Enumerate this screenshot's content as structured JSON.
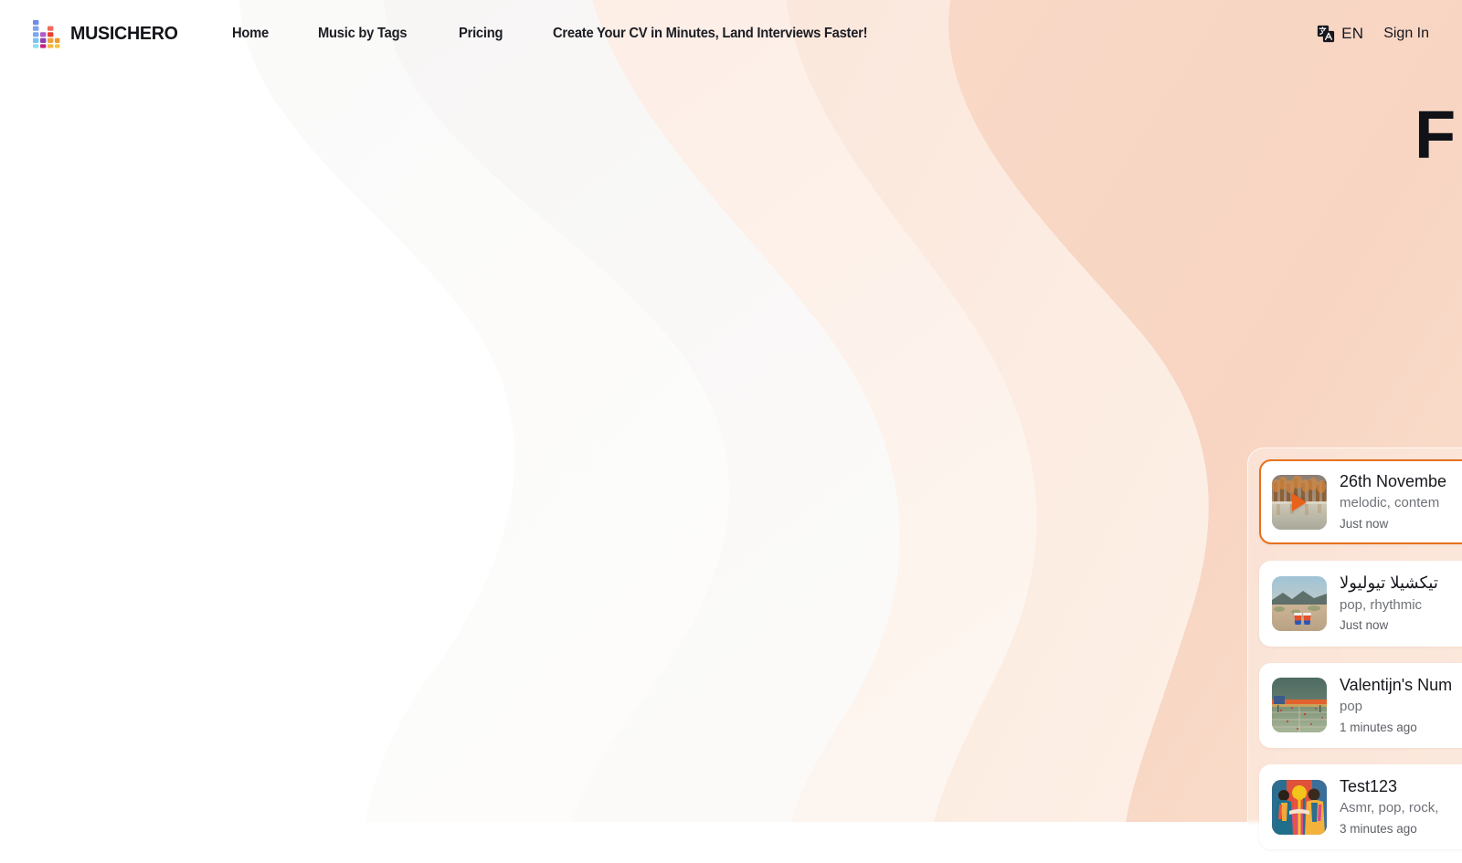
{
  "colors": {
    "accent_orange": "#e8701e",
    "peach_bg": "#f8d7c6",
    "text_dark": "#17181e",
    "text_muted": "#6f7278"
  },
  "header": {
    "brand_name": "MUSICHERO",
    "logo_icon": "equalizer-bars-logo",
    "nav": [
      {
        "label": "Home",
        "name": "home"
      },
      {
        "label": "Music by Tags",
        "name": "music-by-tags"
      },
      {
        "label": "Pricing",
        "name": "pricing"
      },
      {
        "label": "Create Your CV in Minutes, Land Interviews Faster!",
        "name": "cv-promo"
      }
    ],
    "language": {
      "icon": "translate-icon",
      "code": "EN"
    },
    "sign_in_label": "Sign In"
  },
  "hero": {
    "heading_visible_fragment": "F"
  },
  "tracks": [
    {
      "title": "26th Novembe",
      "tags": "melodic, contem",
      "time": "Just now",
      "active": true,
      "playing": true,
      "art": "autumn-lake-reflection"
    },
    {
      "title": "تيكشيلا تيوليولا",
      "tags": "pop, rhythmic",
      "time": "Just now",
      "active": false,
      "playing": false,
      "art": "desert-cocktails"
    },
    {
      "title": "Valentijn's Num",
      "tags": "pop",
      "time": "1 minutes ago",
      "active": false,
      "playing": false,
      "art": "tennis-court-sunset"
    },
    {
      "title": "Test123",
      "tags": "Asmr, pop, rock,",
      "time": "3 minutes ago",
      "active": false,
      "playing": false,
      "art": "abstract-figures-sun"
    }
  ]
}
